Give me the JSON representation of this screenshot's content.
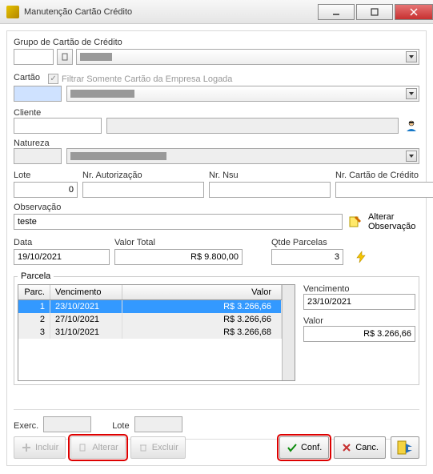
{
  "window": {
    "title": "Manutenção Cartão Crédito"
  },
  "labels": {
    "grupo": "Grupo de Cartão de Crédito",
    "cartao": "Cartão",
    "filtrar": "Filtrar Somente Cartão da Empresa Logada",
    "cliente": "Cliente",
    "natureza": "Natureza",
    "lote": "Lote",
    "nr_autoriz": "Nr. Autorização",
    "nr_nsu": "Nr. Nsu",
    "nr_cartao": "Nr. Cartão de Crédito",
    "observacao": "Observação",
    "alterar_obs": "Alterar Observação",
    "data": "Data",
    "valor_total": "Valor Total",
    "qtde_parcelas": "Qtde Parcelas",
    "parcela": "Parcela",
    "vencimento": "Vencimento",
    "valor": "Valor",
    "exerc": "Exerc.",
    "lote2": "Lote"
  },
  "values": {
    "lote": "0",
    "observacao": "teste",
    "data": "19/10/2021",
    "valor_total": "R$ 9.800,00",
    "qtde_parcelas": "3",
    "vencimento_side": "23/10/2021",
    "valor_side": "R$ 3.266,66"
  },
  "table": {
    "cols": {
      "parc": "Parc.",
      "vencimento": "Vencimento",
      "valor": "Valor"
    },
    "rows": [
      {
        "parc": "1",
        "vencimento": "23/10/2021",
        "valor": "R$ 3.266,66"
      },
      {
        "parc": "2",
        "vencimento": "27/10/2021",
        "valor": "R$ 3.266,66"
      },
      {
        "parc": "3",
        "vencimento": "31/10/2021",
        "valor": "R$ 3.266,68"
      }
    ]
  },
  "buttons": {
    "incluir": "Incluir",
    "alterar": "Alterar",
    "excluir": "Excluir",
    "conf": "Conf.",
    "canc": "Canc."
  },
  "colors": {
    "accent": "#3399ff",
    "danger": "#c73030",
    "ok": "#0a8a0a",
    "warn": "#d00"
  }
}
